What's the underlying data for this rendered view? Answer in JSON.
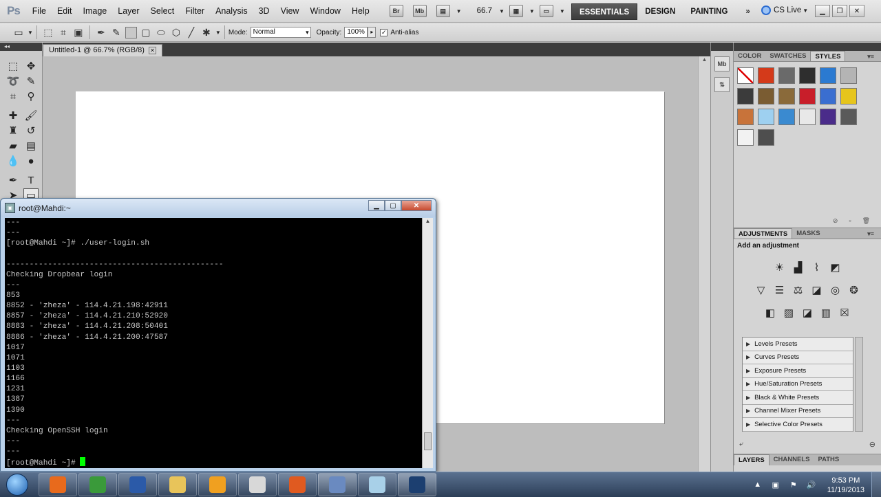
{
  "app": {
    "logo": "Ps",
    "menu": [
      "File",
      "Edit",
      "Image",
      "Layer",
      "Select",
      "Filter",
      "Analysis",
      "3D",
      "View",
      "Window",
      "Help"
    ],
    "bridge_label": "Br",
    "minibridge_label": "Mb",
    "zoom": "66.7",
    "workspaces": [
      "ESSENTIALS",
      "DESIGN",
      "PAINTING"
    ],
    "more": "»",
    "cs_live": "CS Live"
  },
  "options": {
    "mode_label": "Mode:",
    "mode_value": "Normal",
    "opacity_label": "Opacity:",
    "opacity_value": "100%",
    "antialias_label": "Anti-alias",
    "antialias_checked": true
  },
  "document": {
    "tab_title": "Untitled-1 @ 66.7% (RGB/8)"
  },
  "panels": {
    "top_tabs": [
      "COLOR",
      "SWATCHES",
      "STYLES"
    ],
    "active_top_tab": "STYLES",
    "style_swatch_colors": [
      "#ffffff",
      "#d43a1a",
      "#6a6a6a",
      "#2e2e2e",
      "#2b7ad1",
      "#b4b4b4",
      "#3b3b3b",
      "#7a5c32",
      "#8a6a3a",
      "#c81e2a",
      "#3a6ed0",
      "#e6c51c",
      "#c8733a",
      "#9ed0f0",
      "#3a8ad0",
      "#e8e8e8",
      "#4a2c8a",
      "#5a5a5a",
      "#f2f2f2",
      "#4e4e4e"
    ],
    "adjust_tabs": [
      "ADJUSTMENTS",
      "MASKS"
    ],
    "active_adjust_tab": "ADJUSTMENTS",
    "adjust_title": "Add an adjustment",
    "presets": [
      "Levels Presets",
      "Curves Presets",
      "Exposure Presets",
      "Hue/Saturation Presets",
      "Black & White Presets",
      "Channel Mixer Presets",
      "Selective Color Presets"
    ],
    "bottom_tabs": [
      "LAYERS",
      "CHANNELS",
      "PATHS"
    ],
    "active_bottom_tab": "LAYERS"
  },
  "terminal": {
    "title": "root@Mahdi:~",
    "lines": [
      "---",
      "---",
      "[root@Mahdi ~]# ./user-login.sh",
      "",
      "-----------------------------------------------",
      "Checking Dropbear login",
      "---",
      "853",
      "8852 - 'zheza' - 114.4.21.198:42911",
      "8857 - 'zheza' - 114.4.21.210:52920",
      "8883 - 'zheza' - 114.4.21.208:50401",
      "8886 - 'zheza' - 114.4.21.200:47587",
      "1017",
      "1071",
      "1103",
      "1166",
      "1231",
      "1387",
      "1390",
      "---",
      "Checking OpenSSH login",
      "---",
      "---"
    ],
    "prompt": "[root@Mahdi ~]# "
  },
  "taskbar": {
    "apps": [
      {
        "name": "firefox",
        "color": "#e86a1c",
        "open": false
      },
      {
        "name": "chrome",
        "color": "#3a9a3a",
        "open": false
      },
      {
        "name": "word",
        "color": "#2b5aa8",
        "open": false
      },
      {
        "name": "explorer",
        "color": "#e8c45a",
        "open": false
      },
      {
        "name": "avast",
        "color": "#f0a020",
        "open": false
      },
      {
        "name": "usb-tool",
        "color": "#d8d8d8",
        "open": false
      },
      {
        "name": "xampp",
        "color": "#e05a20",
        "open": false
      },
      {
        "name": "putty",
        "color": "#6a8ac0",
        "open": true
      },
      {
        "name": "notepad",
        "color": "#a8d0e8",
        "open": false
      },
      {
        "name": "photoshop",
        "color": "#1c3f70",
        "open": true
      }
    ],
    "time": "9:53 PM",
    "date": "11/19/2013"
  }
}
